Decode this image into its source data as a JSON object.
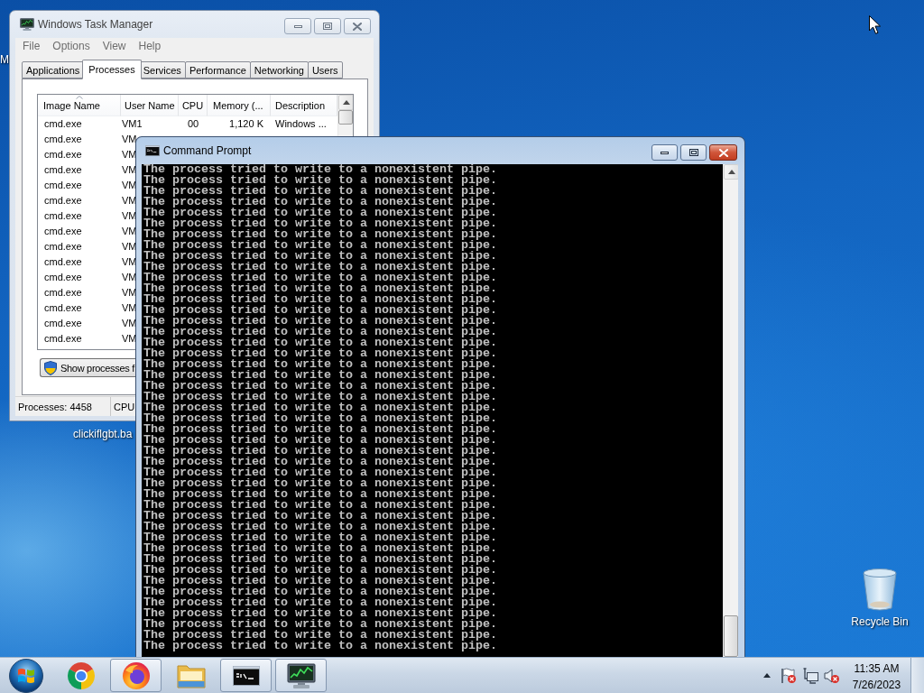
{
  "desktop": {
    "icons": [
      {
        "kind": "covered",
        "label": "M"
      },
      {
        "kind": "covered",
        "label": "clickiflgbt.ba"
      },
      {
        "kind": "recycle_bin",
        "label": "Recycle Bin"
      }
    ]
  },
  "task_manager": {
    "title": "Windows Task Manager",
    "active": false,
    "menu": [
      "File",
      "Options",
      "View",
      "Help"
    ],
    "tabs": [
      {
        "label": "Applications",
        "selected": false
      },
      {
        "label": "Processes",
        "selected": true
      },
      {
        "label": "Services",
        "selected": false
      },
      {
        "label": "Performance",
        "selected": false
      },
      {
        "label": "Networking",
        "selected": false
      },
      {
        "label": "Users",
        "selected": false
      }
    ],
    "table": {
      "columns": [
        {
          "label": "Image Name",
          "sorted": true
        },
        {
          "label": "User Name",
          "sorted": false
        },
        {
          "label": "CPU",
          "sorted": false
        },
        {
          "label": "Memory (...",
          "sorted": false
        },
        {
          "label": "Description",
          "sorted": false
        }
      ],
      "rows": [
        [
          "cmd.exe",
          "VM1",
          "00",
          "1,120 K",
          "Windows ..."
        ],
        [
          "cmd.exe",
          "VM"
        ],
        [
          "cmd.exe",
          "VM"
        ],
        [
          "cmd.exe",
          "VM"
        ],
        [
          "cmd.exe",
          "VM"
        ],
        [
          "cmd.exe",
          "VM"
        ],
        [
          "cmd.exe",
          "VM"
        ],
        [
          "cmd.exe",
          "VM"
        ],
        [
          "cmd.exe",
          "VM"
        ],
        [
          "cmd.exe",
          "VM"
        ],
        [
          "cmd.exe",
          "VM"
        ],
        [
          "cmd.exe",
          "VM"
        ],
        [
          "cmd.exe",
          "VM"
        ],
        [
          "cmd.exe",
          "VM"
        ],
        [
          "cmd.exe",
          "VM"
        ]
      ]
    },
    "button": "Show processes f",
    "status_bar": [
      "Processes: 4458",
      "CPU"
    ]
  },
  "command_prompt": {
    "title": "Command Prompt",
    "active": true,
    "lines": [
      "The process tried to write to a nonexistent pipe.",
      "The process tried to write to a nonexistent pipe.",
      "The process tried to write to a nonexistent pipe.",
      "The process tried to write to a nonexistent pipe.",
      "The process tried to write to a nonexistent pipe.",
      "The process tried to write to a nonexistent pipe.",
      "The process tried to write to a nonexistent pipe.",
      "The process tried to write to a nonexistent pipe.",
      "The process tried to write to a nonexistent pipe.",
      "The process tried to write to a nonexistent pipe.",
      "The process tried to write to a nonexistent pipe.",
      "The process tried to write to a nonexistent pipe.",
      "The process tried to write to a nonexistent pipe.",
      "The process tried to write to a nonexistent pipe.",
      "The process tried to write to a nonexistent pipe.",
      "The process tried to write to a nonexistent pipe.",
      "The process tried to write to a nonexistent pipe.",
      "The process tried to write to a nonexistent pipe.",
      "The process tried to write to a nonexistent pipe.",
      "The process tried to write to a nonexistent pipe.",
      "The process tried to write to a nonexistent pipe.",
      "The process tried to write to a nonexistent pipe.",
      "The process tried to write to a nonexistent pipe.",
      "The process tried to write to a nonexistent pipe.",
      "The process tried to write to a nonexistent pipe.",
      "The process tried to write to a nonexistent pipe.",
      "The process tried to write to a nonexistent pipe.",
      "The process tried to write to a nonexistent pipe.",
      "The process tried to write to a nonexistent pipe.",
      "The process tried to write to a nonexistent pipe.",
      "The process tried to write to a nonexistent pipe.",
      "The process tried to write to a nonexistent pipe.",
      "The process tried to write to a nonexistent pipe.",
      "The process tried to write to a nonexistent pipe.",
      "The process tried to write to a nonexistent pipe.",
      "The process tried to write to a nonexistent pipe.",
      "The process tried to write to a nonexistent pipe.",
      "The process tried to write to a nonexistent pipe.",
      "The process tried to write to a nonexistent pipe.",
      "The process tried to write to a nonexistent pipe.",
      "The process tried to write to a nonexistent pipe.",
      "The process tried to write to a nonexistent pipe.",
      "The process tried to write to a nonexistent pipe.",
      "The process tried to write to a nonexistent pipe.",
      "The process tried to write to a nonexistent pipe."
    ]
  },
  "taskbar": {
    "apps": [
      {
        "kind": "chrome",
        "running": false
      },
      {
        "kind": "firefox",
        "running": true
      },
      {
        "kind": "explorer",
        "running": false
      },
      {
        "kind": "console",
        "running": true
      },
      {
        "kind": "taskmgr",
        "running": true
      }
    ],
    "clock": {
      "time": "11:35 AM",
      "date": "7/26/2023"
    }
  }
}
